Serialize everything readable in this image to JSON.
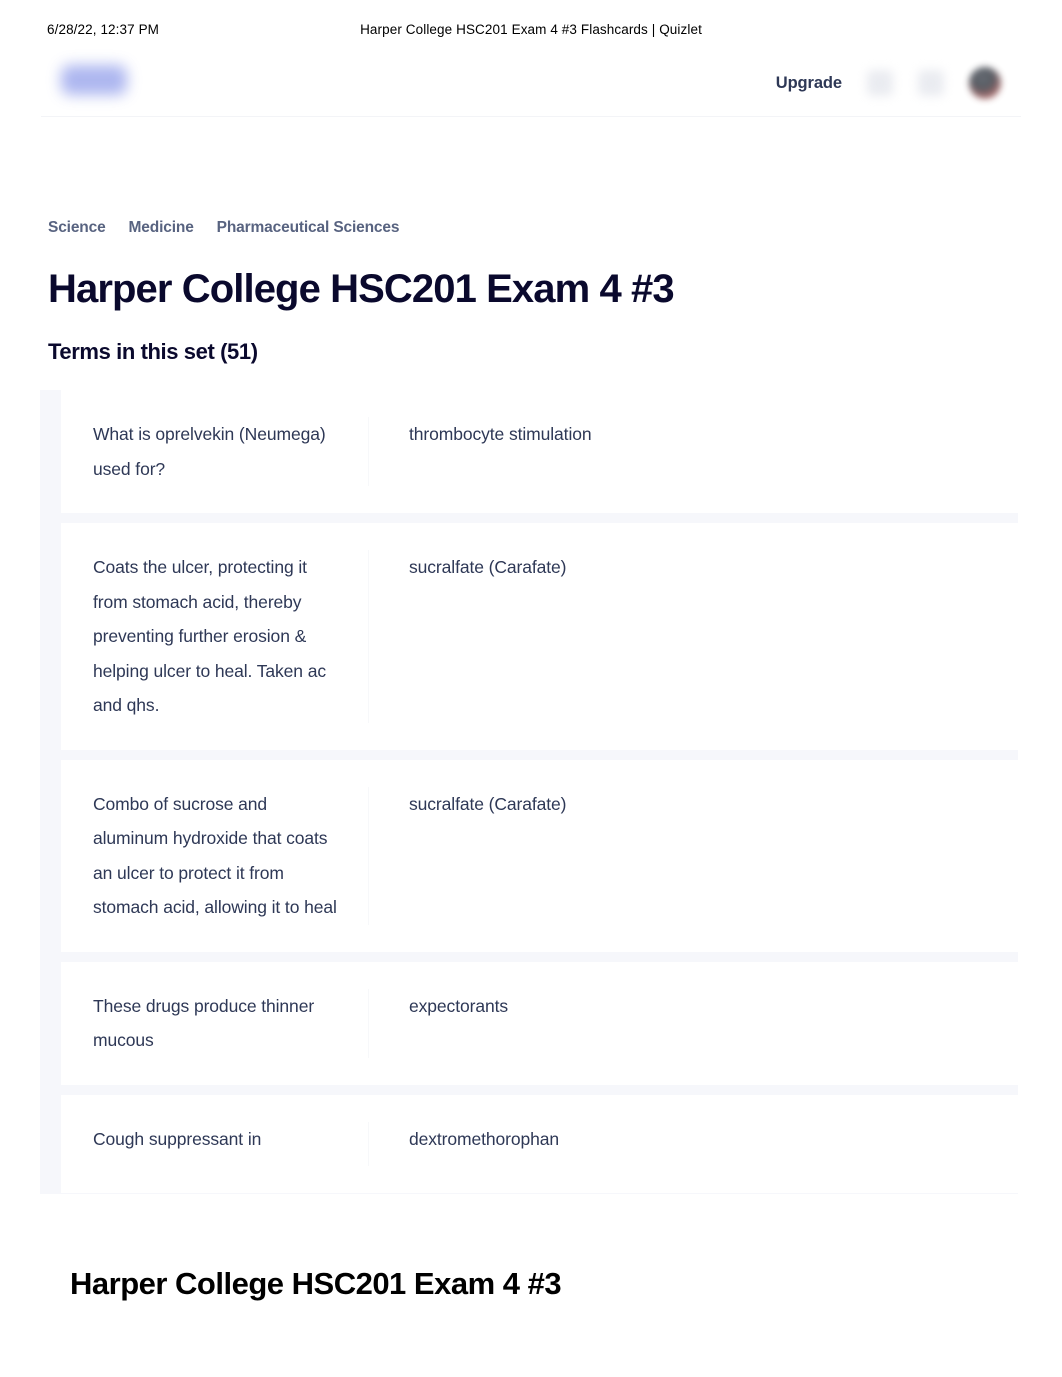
{
  "print_header": {
    "date": "6/28/22, 12:37 PM",
    "title": "Harper College HSC201 Exam 4 #3 Flashcards | Quizlet"
  },
  "nav": {
    "logo_name": "quizlet-logo",
    "upgrade_label": "Upgrade",
    "icons": [
      "search-icon",
      "notifications-icon"
    ],
    "avatar_name": "user-avatar"
  },
  "breadcrumb": {
    "items": [
      {
        "label": "Science"
      },
      {
        "label": "Medicine"
      },
      {
        "label": "Pharmaceutical Sciences"
      }
    ]
  },
  "page": {
    "title": "Harper College HSC201 Exam 4 #3",
    "terms_heading": "Terms in this set (51)",
    "bottom_title": "Harper College HSC201 Exam 4 #3"
  },
  "terms": [
    {
      "term": "What is oprelvekin (Neumega) used for?",
      "definition": "thrombocyte stimulation"
    },
    {
      "term": "Coats the ulcer, protecting it from stomach acid, thereby preventing further erosion & helping ulcer to heal. Taken ac and qhs.",
      "definition": "sucralfate (Carafate)"
    },
    {
      "term": "Combo of sucrose and aluminum hydroxide that coats an ulcer to protect it from stomach acid, allowing it to heal",
      "definition": "sucralfate (Carafate)"
    },
    {
      "term": "These drugs produce thinner mucous",
      "definition": "expectorants"
    },
    {
      "term": "Cough suppressant in",
      "definition": "dextromethorophan"
    }
  ],
  "colors": {
    "text_primary": "#0a092d",
    "text_body": "#2e3856",
    "breadcrumb": "#586380",
    "page_bg": "#ffffff",
    "list_bg": "#f6f7fb",
    "logo_blue": "#8e9bea"
  }
}
